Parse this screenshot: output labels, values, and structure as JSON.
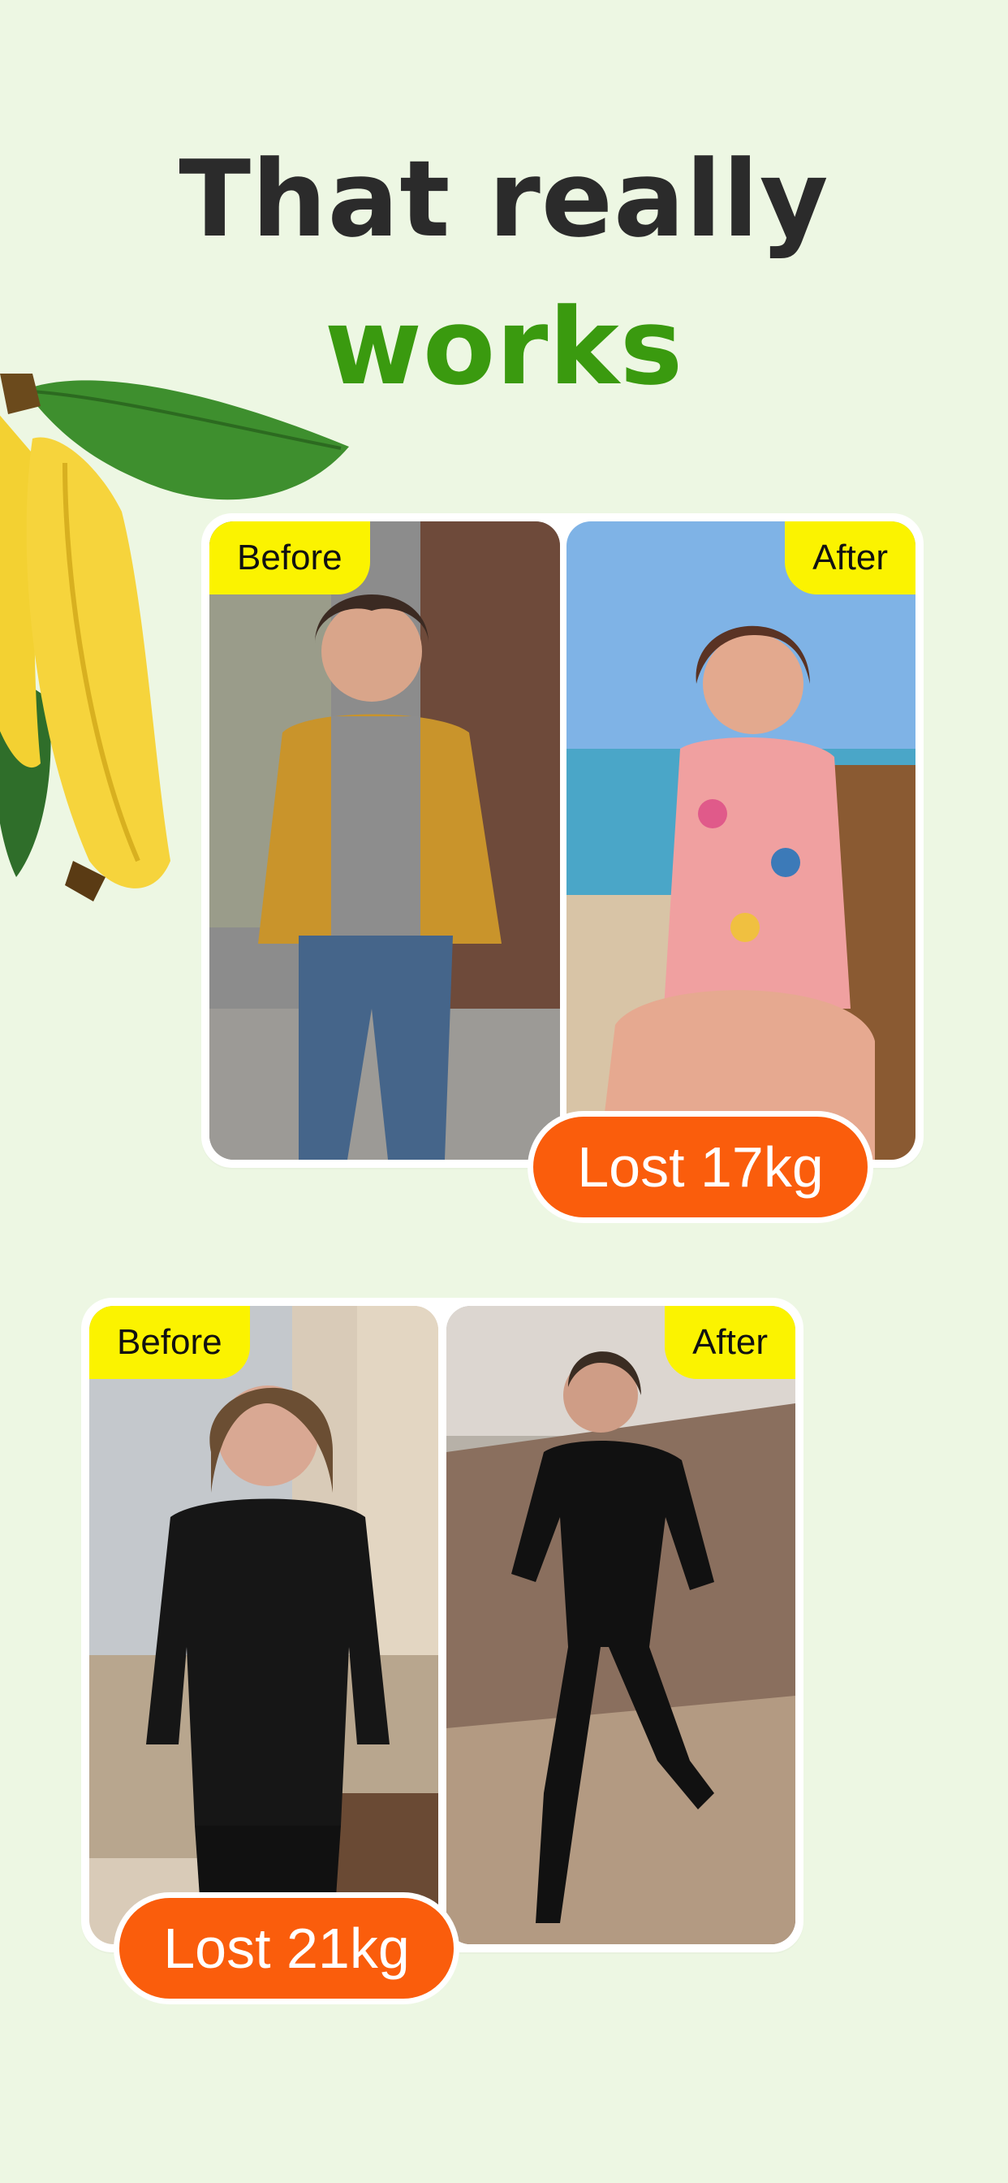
{
  "headline": {
    "line1": "That really",
    "line2": "works",
    "line2_color": "#3a9a0f"
  },
  "decoration": {
    "icon": "banana-bunch-illustration"
  },
  "stories": [
    {
      "before_label": "Before",
      "after_label": "After",
      "result": "Lost 17kg"
    },
    {
      "before_label": "Before",
      "after_label": "After",
      "result": "Lost 21kg"
    }
  ],
  "colors": {
    "background": "#edf7e3",
    "tag": "#fbf300",
    "badge": "#fa5d0c"
  }
}
